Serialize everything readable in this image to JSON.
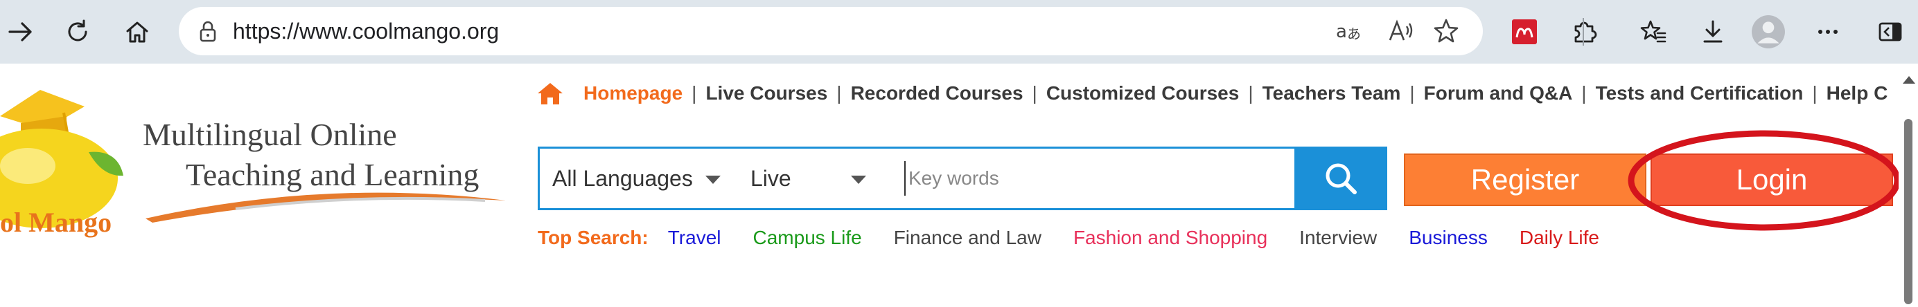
{
  "browser": {
    "url": "https://www.coolmango.org",
    "icons": {
      "forward": "forward-arrow-icon",
      "reload": "reload-icon",
      "home": "home-icon",
      "lock": "lock-icon",
      "translate": "translate-icon",
      "read_aloud": "read-aloud-icon",
      "favorite": "star-icon",
      "extension_red": "mendeley-extension-icon",
      "extensions": "puzzle-icon",
      "favorites": "favorites-icon",
      "downloads": "download-icon",
      "profile": "profile-avatar-icon",
      "more": "more-dots-icon",
      "sidebar": "sidebar-toggle-icon"
    }
  },
  "logo": {
    "line1": "Multilingual Online",
    "line2": "Teaching and Learning",
    "brand": "ol Mango"
  },
  "nav": {
    "home_icon": "home-icon",
    "items": [
      {
        "label": "Homepage",
        "active": true
      },
      {
        "label": "Live Courses"
      },
      {
        "label": "Recorded Courses"
      },
      {
        "label": "Customized Courses"
      },
      {
        "label": "Teachers Team"
      },
      {
        "label": "Forum and Q&A"
      },
      {
        "label": "Tests and Certification"
      },
      {
        "label": "Help C"
      }
    ],
    "separator": "|"
  },
  "search": {
    "language": "All Languages",
    "mode": "Live",
    "placeholder": "Key words",
    "button_icon": "search-icon"
  },
  "buttons": {
    "register": "Register",
    "login": "Login"
  },
  "top_search": {
    "label": "Top Search:",
    "tags": [
      {
        "label": "Travel",
        "color": "#1a1ad8"
      },
      {
        "label": "Campus Life",
        "color": "#1a9a1a"
      },
      {
        "label": "Finance and Law",
        "color": "#444444"
      },
      {
        "label": "Fashion and Shopping",
        "color": "#e8305a"
      },
      {
        "label": "Interview",
        "color": "#444444"
      },
      {
        "label": "Business",
        "color": "#1a1ad8"
      },
      {
        "label": "Daily Life",
        "color": "#d81a1a"
      }
    ]
  },
  "colors": {
    "accent_orange": "#f26a1c",
    "search_blue": "#1b90d8",
    "register_bg": "#fd7f34",
    "login_bg": "#f85a3a",
    "annotation_red": "#d4141c"
  }
}
